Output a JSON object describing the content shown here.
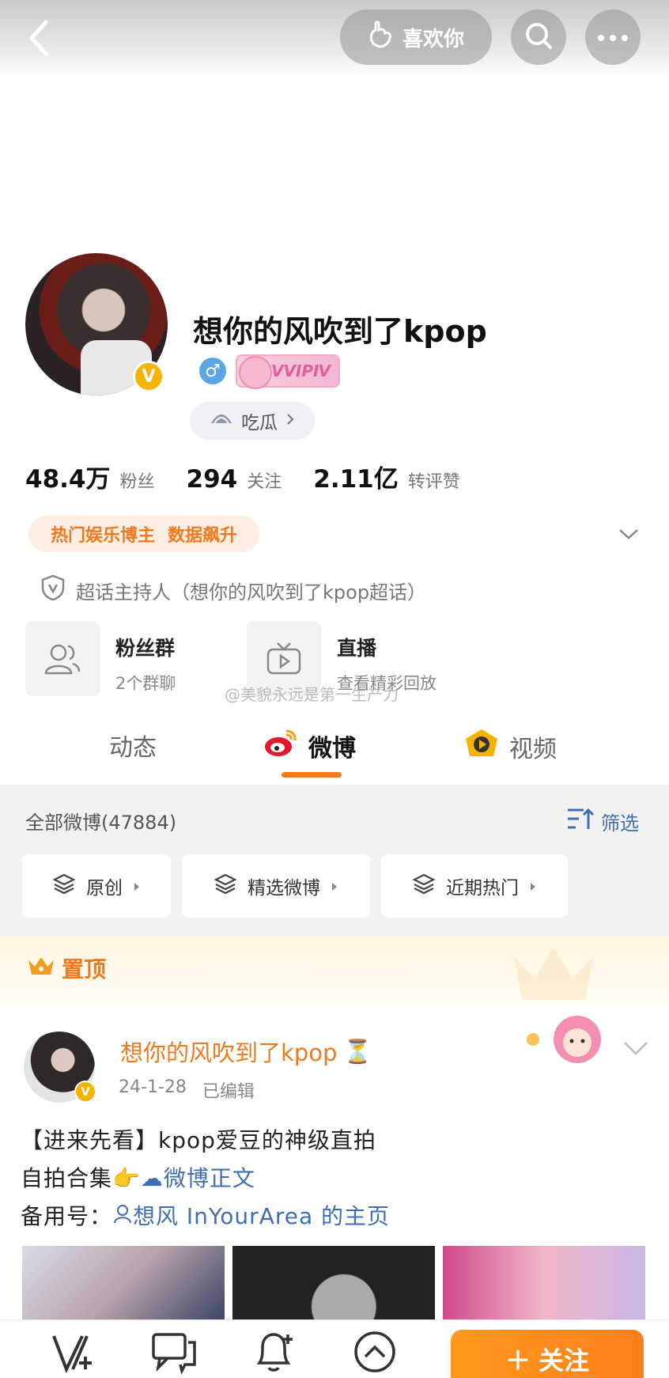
{
  "top_bar": {
    "like_label": "喜欢你"
  },
  "profile": {
    "name": "想你的风吹到了kpop",
    "verified_badge": "V",
    "gender_symbol": "♂",
    "vip_label": "VVIPⅣ",
    "tag_label": "吃瓜",
    "stats": [
      {
        "num": "48.4万",
        "label": "粉丝"
      },
      {
        "num": "294",
        "label": "关注"
      },
      {
        "num": "2.11亿",
        "label": "转评赞"
      }
    ],
    "hot_badge": [
      "热门娱乐博主",
      "数据飙升"
    ],
    "host_text": "超话主持人（想你的风吹到了kpop超话）",
    "fan_group": {
      "title": "粉丝群",
      "sub": "2个群聊"
    },
    "live": {
      "title": "直播",
      "sub": "查看精彩回放"
    },
    "watermark": "@美貌永远是第一生产力"
  },
  "tabs": [
    {
      "label": "动态"
    },
    {
      "label": "微博"
    },
    {
      "label": "视频"
    }
  ],
  "feed": {
    "all_posts": "全部微博(47884)",
    "filter_label": "筛选",
    "chips": [
      "原创",
      "精选微博",
      "近期热门"
    ],
    "pinned_label": "置顶"
  },
  "post": {
    "author": "想你的风吹到了kpop",
    "author_emoji": "⏳",
    "date": "24-1-28",
    "edited": "已编辑",
    "line1": "【进来先看】kpop爱豆的神级直拍",
    "line2_prefix": "自拍合集",
    "line2_emoji": "👉",
    "line2_link": "微博正文",
    "line3_prefix": "备用号：",
    "line3_link": "想风 InYourArea 的主页"
  },
  "bottom_bar": {
    "follow_label": "关注"
  },
  "colors": {
    "accent_orange": "#f07a1e",
    "link_blue": "#3e6fb0",
    "vip_gold": "#f6b400"
  }
}
